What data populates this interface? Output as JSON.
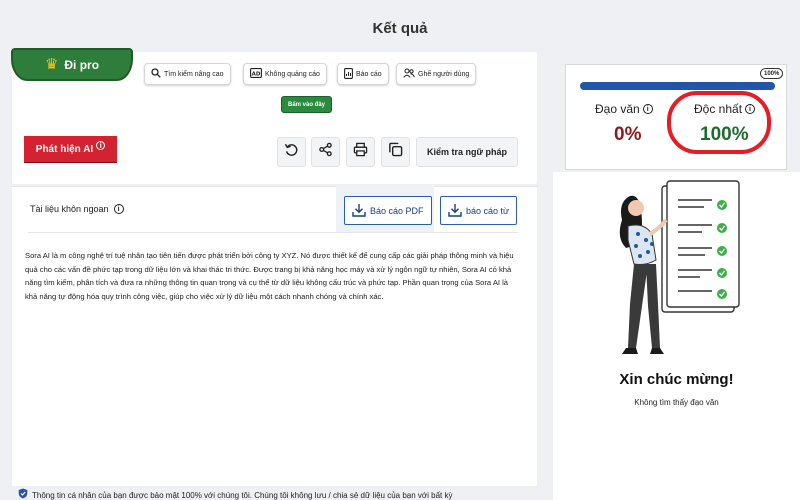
{
  "page": {
    "title": "Kết quả"
  },
  "toolbar": {
    "go_pro": "Đi pro",
    "chips": [
      {
        "label": "Tìm kiếm nâng cao",
        "icon": "search-icon"
      },
      {
        "label": "Không quảng cáo",
        "icon": "ad-block-icon"
      },
      {
        "label": "Báo cáo",
        "icon": "report-icon"
      },
      {
        "label": "Ghế người dùng",
        "icon": "users-icon"
      }
    ],
    "click_here": "Bấm vào đây",
    "ai_detect": "Phát hiện AI",
    "grammar_check": "Kiểm tra ngữ pháp"
  },
  "document": {
    "title": "Tài liệu khôn ngoan",
    "pdf_report": "Báo cáo PDF",
    "word_report": "báo cáo từ",
    "text": "Sora AI là m công nghệ trí tuệ nhân tạo tiên tiến được phát triển bởi công ty XYZ. Nó được thiết kế để cung cấp các giải pháp thông minh và hiệu quả cho các vấn đề phức tạp trong dữ liệu lớn và khai thác tri thức. Được trang bị khả năng học máy và xử lý ngôn ngữ tự nhiên, Sora AI có khả năng tìm kiếm, phân tích và đưa ra những thông tin quan trọng và cụ thể từ dữ liệu không cấu trúc và phức tạp. Phần quan trọng của Sora AI là khả năng tự động hóa quy trình công việc, giúp cho việc xử lý dữ liệu một cách nhanh chóng và chính xác."
  },
  "results": {
    "progress_percent": 100,
    "progress_label": "100%",
    "plagiarism_label": "Đạo văn",
    "plagiarism_value": "0%",
    "unique_label": "Độc nhất",
    "unique_value": "100%",
    "congrats": "Xin chúc mừng!",
    "no_plagiarism": "Không tìm thấy đạo văn"
  },
  "footer": {
    "privacy": "Thông tin cá nhân của bạn được bảo mật 100% với chúng tôi. Chúng tôi không lưu / chia sẻ dữ liệu của bạn với bất kỳ"
  },
  "colors": {
    "accent_green": "#2f7d3a",
    "ai_red": "#d32230",
    "plagiarism_red": "#8b1a1a",
    "unique_green": "#1f6b2e",
    "progress_blue": "#2356a6",
    "highlight_ring": "#e41e26"
  }
}
